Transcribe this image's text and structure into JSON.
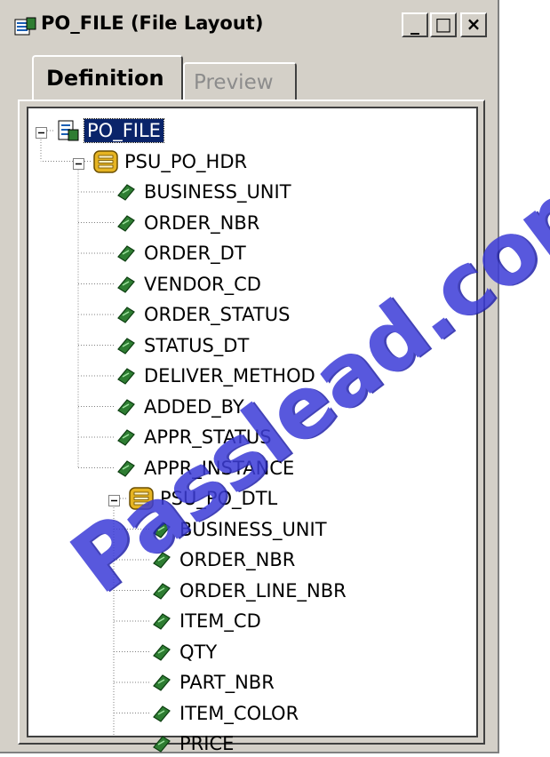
{
  "window": {
    "title": "PO_FILE (File Layout)"
  },
  "controls": {
    "minimize": "_",
    "maximize": "□",
    "close": "×"
  },
  "tabs": [
    {
      "label": "Definition",
      "active": true
    },
    {
      "label": "Preview",
      "active": false
    }
  ],
  "tree": {
    "root": {
      "label": "PO_FILE",
      "icon": "file-layout-icon",
      "selected": true
    },
    "records": [
      {
        "label": "PSU_PO_HDR",
        "icon": "record-icon",
        "fields": [
          "BUSINESS_UNIT",
          "ORDER_NBR",
          "ORDER_DT",
          "VENDOR_CD",
          "ORDER_STATUS",
          "STATUS_DT",
          "DELIVER_METHOD",
          "ADDED_BY",
          "APPR_STATUS",
          "APPR_INSTANCE"
        ]
      },
      {
        "label": "PSU_PO_DTL",
        "icon": "record-icon",
        "fields": [
          "BUSINESS_UNIT",
          "ORDER_NBR",
          "ORDER_LINE_NBR",
          "ITEM_CD",
          "QTY",
          "PART_NBR",
          "ITEM_COLOR",
          "PRICE"
        ]
      }
    ]
  },
  "watermark": "Passlead.com",
  "colors": {
    "selection": "#0a246a",
    "watermark": "#3c3cd8",
    "field_icon": "#2e7d32",
    "record_icon": "#e6b422"
  }
}
